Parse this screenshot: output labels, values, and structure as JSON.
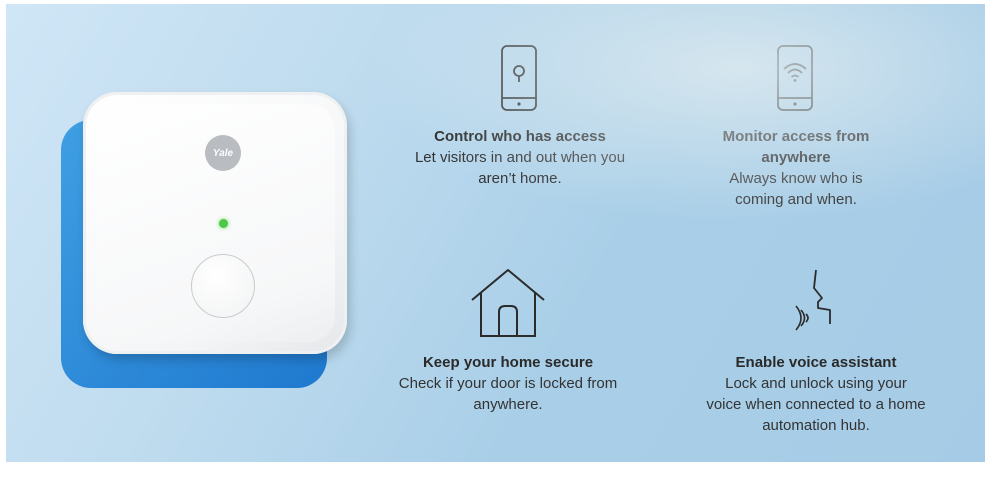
{
  "device": {
    "brand_logo": "Yale",
    "icon": "smart-hub-device"
  },
  "features": [
    {
      "icon": "smartphone-keyhole-icon",
      "title": "Control who has access",
      "desc": "Let visitors in and out when you aren’t home."
    },
    {
      "icon": "smartphone-wifi-icon",
      "title": "Monitor access from anywhere",
      "desc": "Always know who is coming and when."
    },
    {
      "icon": "house-icon",
      "title": "Keep your home secure",
      "desc": "Check if your door is locked from anywhere."
    },
    {
      "icon": "voice-profile-icon",
      "title": "Enable voice assistant",
      "desc": "Lock and unlock using your voice when connected to a home automation hub."
    }
  ],
  "colors": {
    "accent_blue": "#1f79cf",
    "led_green": "#4fc84a",
    "background": "#b8d7ee"
  }
}
